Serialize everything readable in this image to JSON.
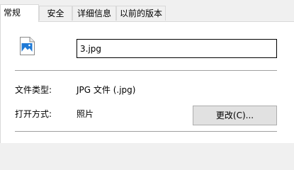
{
  "tabs": [
    {
      "label": "常规",
      "active": true
    },
    {
      "label": "安全",
      "active": false
    },
    {
      "label": "详细信息",
      "active": false
    },
    {
      "label": "以前的版本",
      "active": false
    }
  ],
  "file": {
    "icon": "image-file-icon",
    "name": "3.jpg"
  },
  "properties": {
    "type_label": "文件类型:",
    "type_value": "JPG 文件 (.jpg)",
    "opens_with_label": "打开方式:",
    "opens_with_value": "照片",
    "change_button_label": "更改(C)..."
  },
  "colors": {
    "icon_blue": "#1f7ad6",
    "button_face": "#e1e1e1",
    "divider": "#a0a0a0"
  }
}
